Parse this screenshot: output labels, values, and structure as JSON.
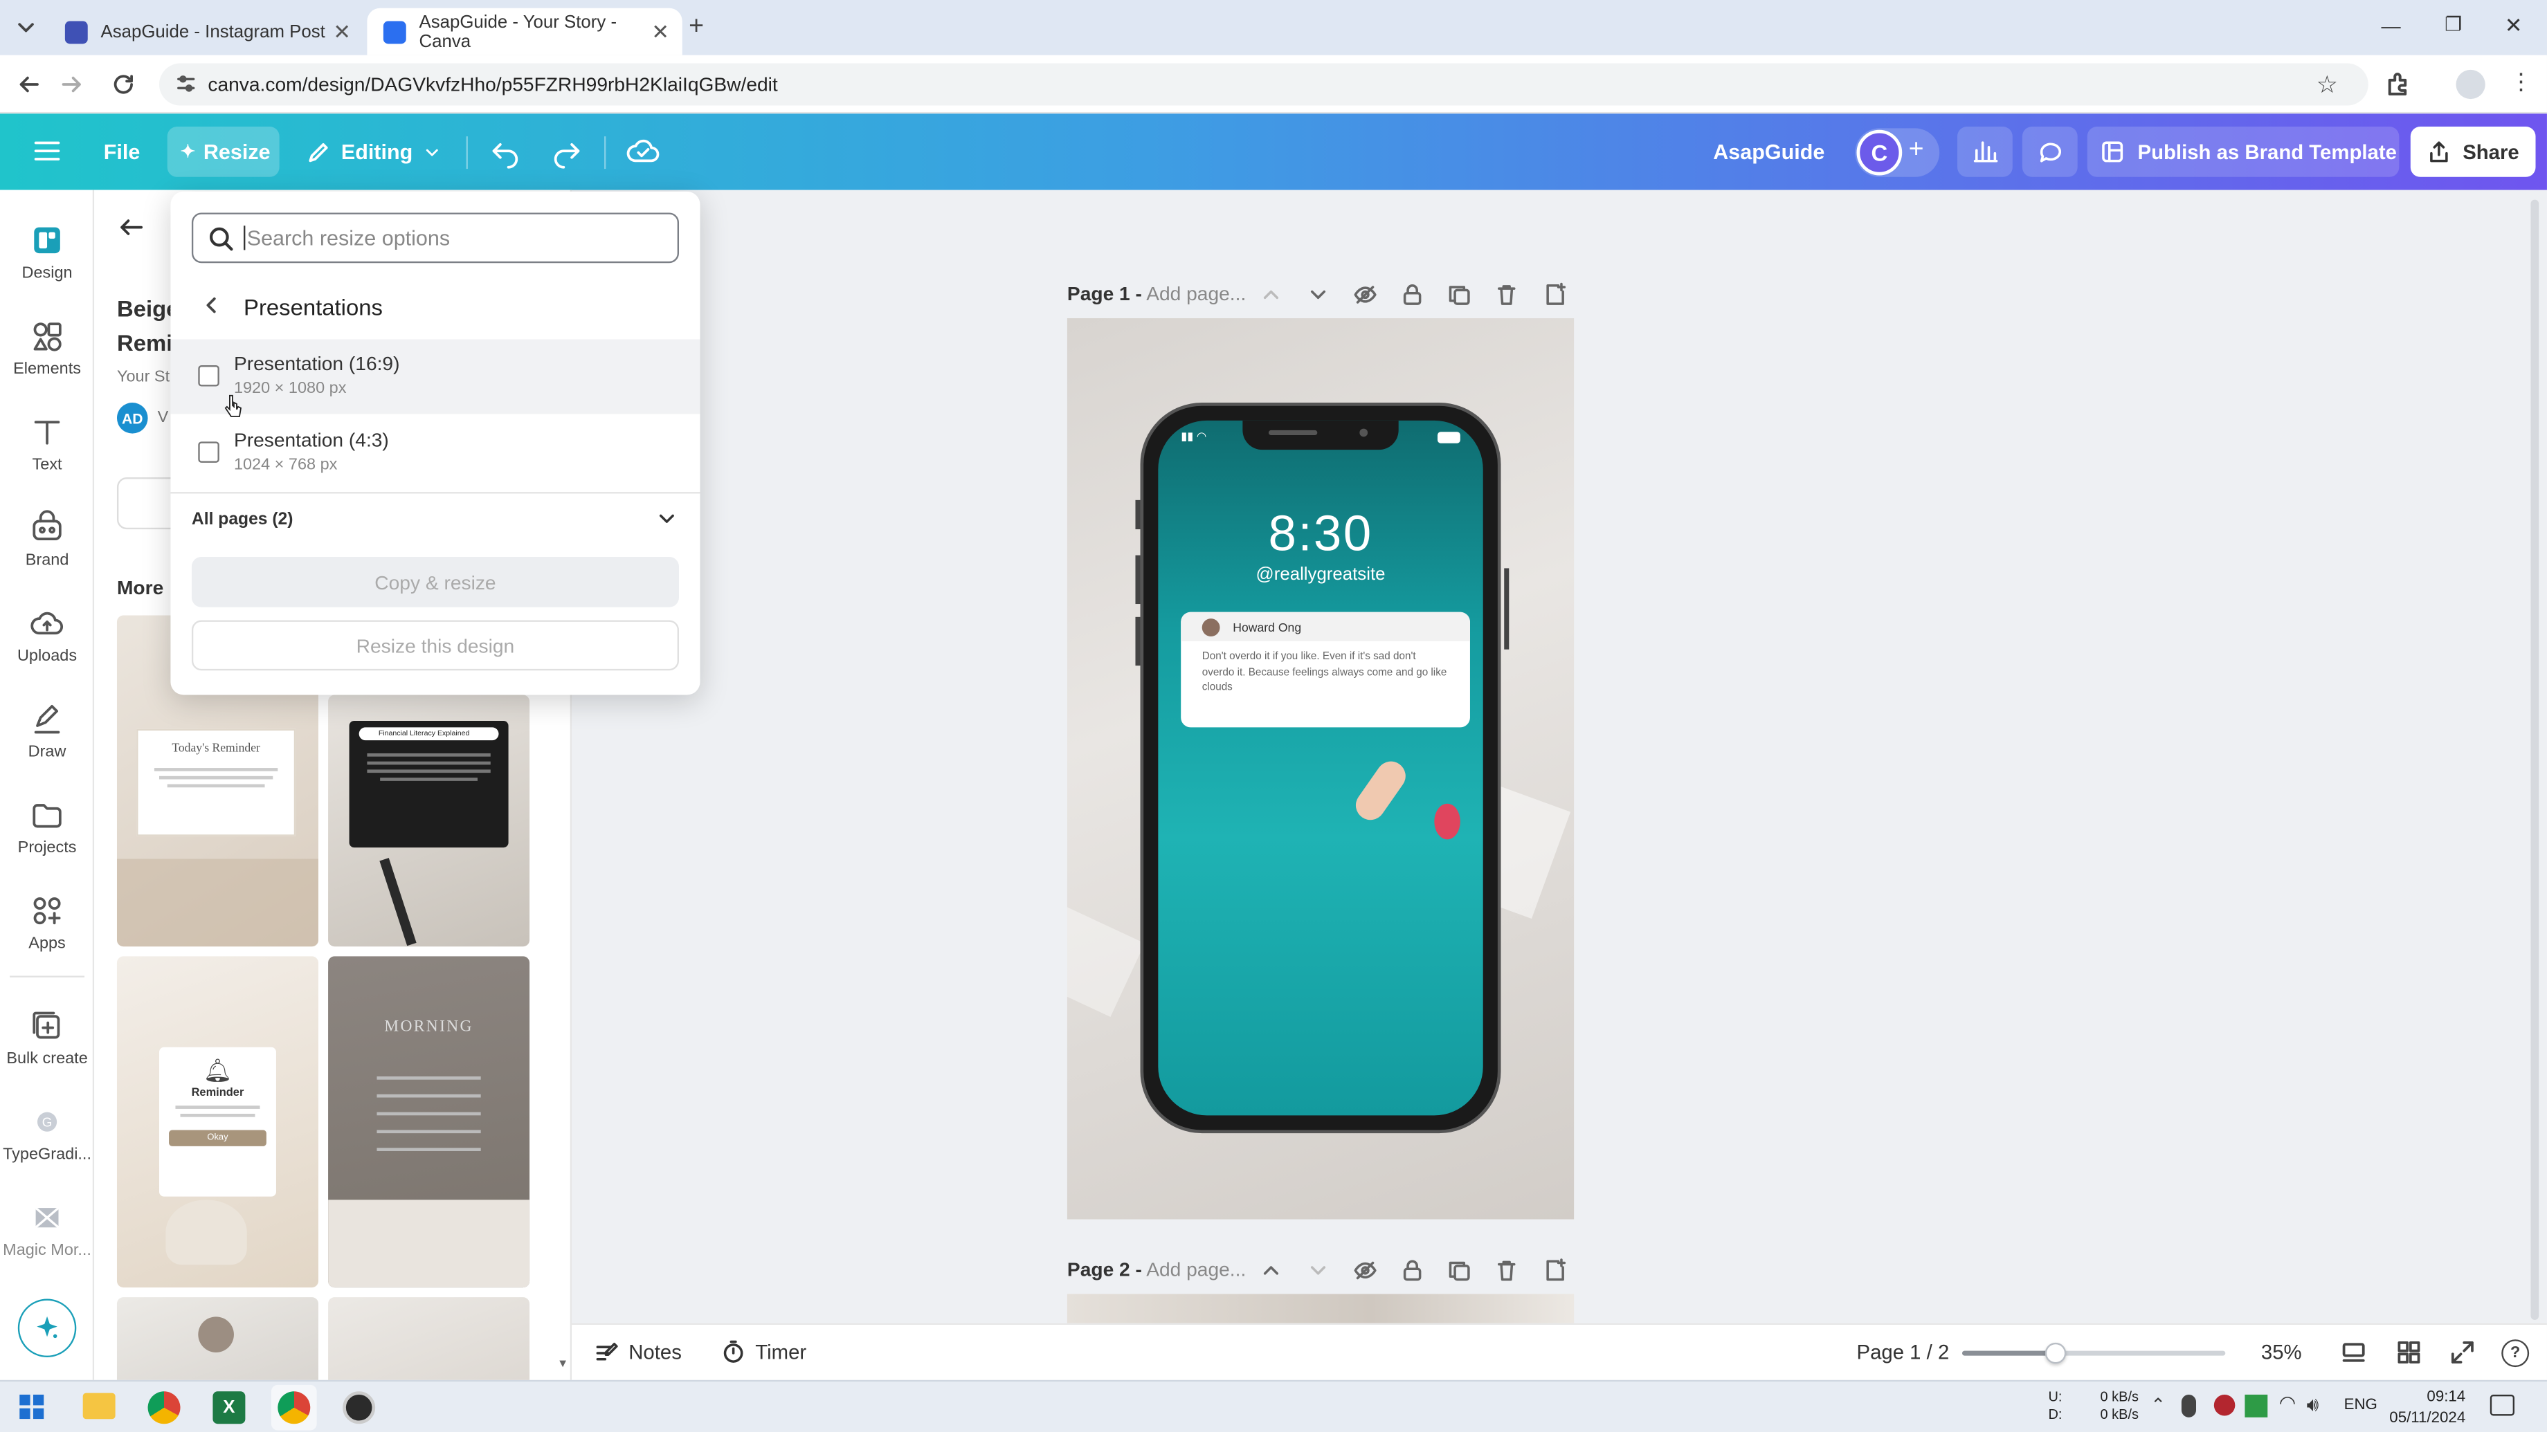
{
  "browser": {
    "tabs": [
      {
        "title": "AsapGuide - Instagram Post",
        "active": false
      },
      {
        "title": "AsapGuide - Your Story - Canva",
        "active": true
      }
    ],
    "url": "canva.com/design/DAGVkvfzHho/p55FZRH99rbH2KlaiIqGBw/edit"
  },
  "topbar": {
    "file_label": "File",
    "resize_label": "Resize",
    "editing_label": "Editing",
    "team_name": "AsapGuide",
    "avatar_initial": "C",
    "publish_label": "Publish as Brand Template",
    "share_label": "Share"
  },
  "rail": {
    "items": [
      {
        "label": "Design",
        "icon": "design-icon"
      },
      {
        "label": "Elements",
        "icon": "elements-icon"
      },
      {
        "label": "Text",
        "icon": "text-icon"
      },
      {
        "label": "Brand",
        "icon": "brand-icon"
      },
      {
        "label": "Uploads",
        "icon": "uploads-icon"
      },
      {
        "label": "Draw",
        "icon": "draw-icon"
      },
      {
        "label": "Projects",
        "icon": "projects-icon"
      },
      {
        "label": "Apps",
        "icon": "apps-icon"
      },
      {
        "label": "Bulk create",
        "icon": "bulk-create-icon"
      },
      {
        "label": "TypeGradi...",
        "icon": "typegradient-icon"
      },
      {
        "label": "Magic Mor...",
        "icon": "magic-morph-icon"
      }
    ]
  },
  "panel": {
    "title_line1": "Beige",
    "title_line2": "Remi",
    "subtitle": "Your St",
    "author_initials": "AD",
    "author_name": "V",
    "more_label": "More",
    "templates": [
      {
        "heading": "Today's Reminder"
      },
      {
        "heading": "Financial Literacy Explained"
      },
      {
        "heading": "Reminder",
        "button": "Okay"
      },
      {
        "heading": "MORNING"
      }
    ]
  },
  "resize_popup": {
    "search_placeholder": "Search resize options",
    "category": "Presentations",
    "options": [
      {
        "name": "Presentation (16:9)",
        "size": "1920 × 1080 px"
      },
      {
        "name": "Presentation (4:3)",
        "size": "1024 × 768 px"
      }
    ],
    "pages_label": "All pages (2)",
    "copy_resize_label": "Copy & resize",
    "resize_design_label": "Resize this design"
  },
  "canvas": {
    "page1_label": "Page 1 -",
    "page1_title_placeholder": "Add page...",
    "page2_label": "Page 2 -",
    "page2_title_placeholder": "Add page...",
    "phone": {
      "time": "8:30",
      "handle": "@reallygreatsite",
      "notif_name": "Howard Ong",
      "notif_text": "Don't overdo it if you like. Even if it's sad don't overdo it. Because feelings always come and go like clouds"
    }
  },
  "bottombar": {
    "notes_label": "Notes",
    "timer_label": "Timer",
    "page_counter": "Page 1 / 2",
    "zoom": "35%",
    "zoom_fraction": 0.35
  },
  "taskbar": {
    "net_up_label": "U:",
    "net_down_label": "D:",
    "net_up": "0 kB/s",
    "net_down": "0 kB/s",
    "language": "ENG",
    "time": "09:14",
    "date": "05/11/2024"
  },
  "colors": {
    "accent": "#1a9fb8",
    "header_start": "#20c4cb",
    "header_end": "#6f55ef",
    "phone_screen": "#1aa6a8"
  }
}
